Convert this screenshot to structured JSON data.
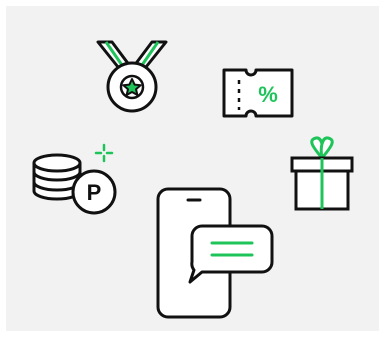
{
  "icons": {
    "medal": "medal-icon",
    "coupon": "coupon-icon",
    "points": "points-coins-icon",
    "gift": "gift-box-icon",
    "phone": "smartphone-icon",
    "message": "chat-bubble-icon"
  },
  "coupon_symbol": "%",
  "points_symbol": "P",
  "colors": {
    "background": "#f2f2f2",
    "outline": "#111111",
    "accent": "#1ec45a"
  }
}
